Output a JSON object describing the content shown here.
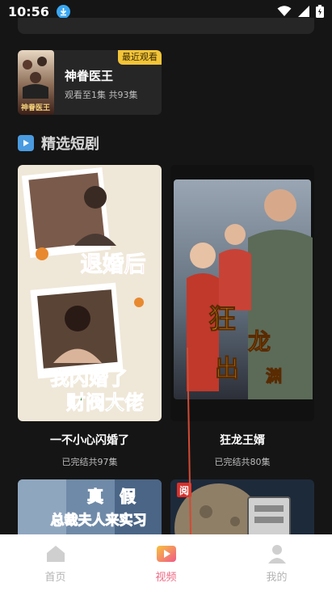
{
  "status": {
    "time": "10:56"
  },
  "recent": {
    "badge": "最近观看",
    "title": "神眷医王",
    "progress": "观看至1集 共93集",
    "cover_text": "神眷医王"
  },
  "section": {
    "title": "精选短剧"
  },
  "dramas": [
    {
      "title": "一不小心闪婚了",
      "sub": "已完结共97集",
      "cover_lines": [
        "退婚后",
        "我闪婚了",
        "财阀大佬"
      ]
    },
    {
      "title": "狂龙王婿",
      "sub": "已完结共80集",
      "cover_lines": [
        "狂",
        "龙",
        "出",
        "渊"
      ]
    }
  ],
  "next_cards": [
    {
      "cover_lines": [
        "真",
        "假",
        "总裁夫人来实习"
      ]
    },
    {
      "badge": "阅"
    }
  ],
  "tabs": [
    {
      "label": "首页",
      "icon": "home-icon",
      "active": false
    },
    {
      "label": "视频",
      "icon": "video-icon",
      "active": true
    },
    {
      "label": "我的",
      "icon": "profile-icon",
      "active": false
    }
  ],
  "colors": {
    "accent": "#f06a84",
    "badge": "#f2c438",
    "section_icon": "#4a9be0"
  }
}
